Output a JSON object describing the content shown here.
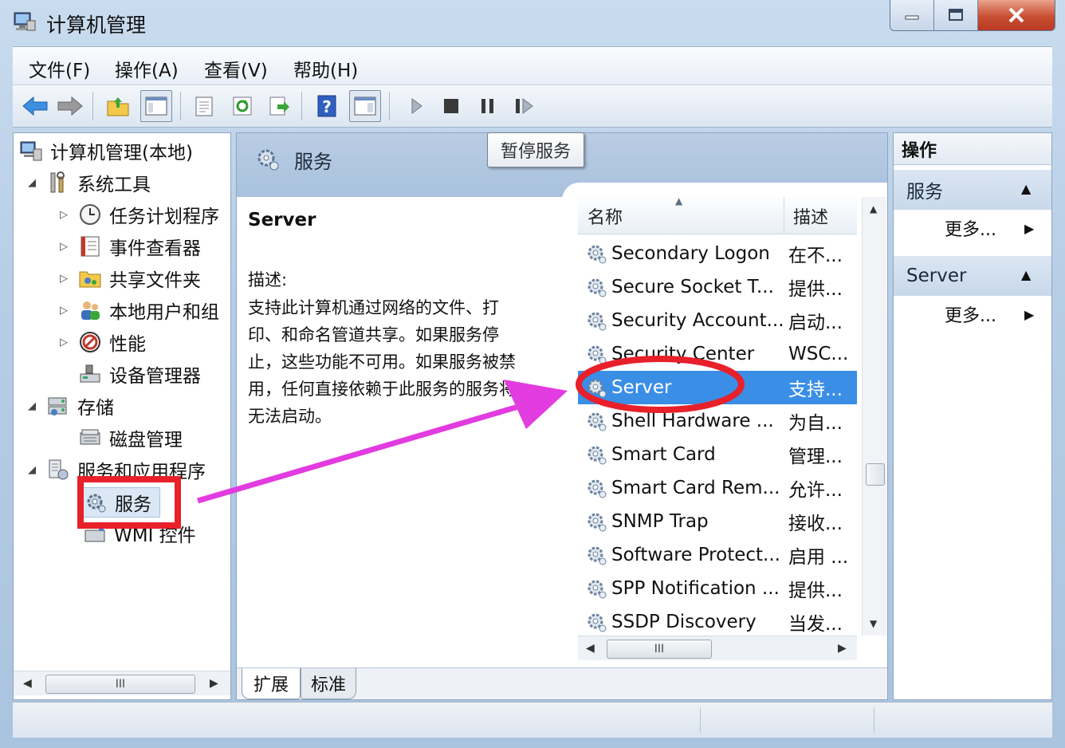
{
  "window": {
    "title": "计算机管理"
  },
  "menu": {
    "file": "文件(F)",
    "action": "操作(A)",
    "view": "查看(V)",
    "help": "帮助(H)"
  },
  "tooltip": "暂停服务",
  "tree": {
    "root": "计算机管理(本地)",
    "system_tools": "系统工具",
    "task_scheduler": "任务计划程序",
    "event_viewer": "事件查看器",
    "shared_folders": "共享文件夹",
    "local_users": "本地用户和组",
    "performance": "性能",
    "device_manager": "设备管理器",
    "storage": "存储",
    "disk_management": "磁盘管理",
    "services_apps": "服务和应用程序",
    "services": "服务",
    "wmi": "WMI 控件"
  },
  "left_scroll_grip": "III",
  "services_panel": {
    "header_title": "服务",
    "selected_name": "Server",
    "desc_label": "描述:",
    "desc_lines": [
      "支持此计算机通过网络的文件、打",
      "印、和命名管道共享。如果服务停",
      "止，这些功能不可用。如果服务被禁",
      "用，任何直接依赖于此服务的服务将",
      "无法启动。"
    ],
    "col_name": "名称",
    "col_desc": "描述",
    "rows": [
      {
        "name": "Secondary Logon",
        "desc": "在不..."
      },
      {
        "name": "Secure Socket T...",
        "desc": "提供..."
      },
      {
        "name": "Security Account...",
        "desc": "启动..."
      },
      {
        "name": "Security Center",
        "desc": "WSC..."
      },
      {
        "name": "Server",
        "desc": "支持..."
      },
      {
        "name": "Shell Hardware ...",
        "desc": "为自..."
      },
      {
        "name": "Smart Card",
        "desc": "管理..."
      },
      {
        "name": "Smart Card Rem...",
        "desc": "允许..."
      },
      {
        "name": "SNMP Trap",
        "desc": "接收..."
      },
      {
        "name": "Software Protect...",
        "desc": "启用 ..."
      },
      {
        "name": "SPP Notification ...",
        "desc": "提供..."
      },
      {
        "name": "SSDP Discovery",
        "desc": "当发..."
      }
    ],
    "selected_index": 4,
    "hscroll_grip": "III",
    "tab_extended": "扩展",
    "tab_standard": "标准"
  },
  "actions_panel": {
    "header": "操作",
    "group1": "服务",
    "group1_more": "更多...",
    "group2": "Server",
    "group2_more": "更多..."
  },
  "colors": {
    "selection": "#3a8ee6",
    "annotation_red": "#e8202a",
    "annotation_arrow": "#e23ce0"
  }
}
